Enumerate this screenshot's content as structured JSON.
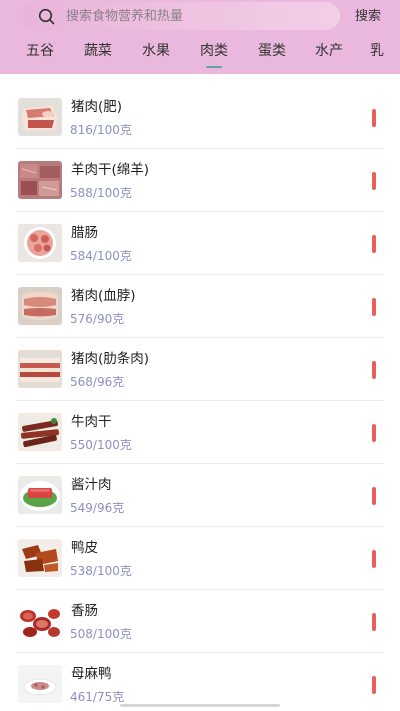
{
  "search": {
    "placeholder": "搜索食物营养和热量",
    "button_label": "搜索"
  },
  "tabs": [
    {
      "label": "五谷",
      "active": false
    },
    {
      "label": "蔬菜",
      "active": false
    },
    {
      "label": "水果",
      "active": false
    },
    {
      "label": "肉类",
      "active": true
    },
    {
      "label": "蛋类",
      "active": false
    },
    {
      "label": "水产",
      "active": false
    },
    {
      "label": "乳",
      "active": false
    }
  ],
  "colors": {
    "header_bg": "#eab8dd",
    "active_underline": "#5aa7a4",
    "calorie_text": "#8c8fc4",
    "indicator_bar": "#e95f5c"
  },
  "foods": [
    {
      "name": "猪肉(肥)",
      "calories": "816/100克",
      "image": "pork-fat-image"
    },
    {
      "name": "羊肉干(绵羊)",
      "calories": "588/100克",
      "image": "dried-mutton-image"
    },
    {
      "name": "腊肠",
      "calories": "584/100克",
      "image": "chinese-sausage-image"
    },
    {
      "name": "猪肉(血脖)",
      "calories": "576/90克",
      "image": "pork-neck-image"
    },
    {
      "name": "猪肉(肋条肉)",
      "calories": "568/96克",
      "image": "pork-rib-image"
    },
    {
      "name": "牛肉干",
      "calories": "550/100克",
      "image": "beef-jerky-image"
    },
    {
      "name": "酱汁肉",
      "calories": "549/96克",
      "image": "sauce-meat-image"
    },
    {
      "name": "鸭皮",
      "calories": "538/100克",
      "image": "duck-skin-image"
    },
    {
      "name": "香肠",
      "calories": "508/100克",
      "image": "sausage-image"
    },
    {
      "name": "母麻鸭",
      "calories": "461/75克",
      "image": "duck-image"
    }
  ]
}
